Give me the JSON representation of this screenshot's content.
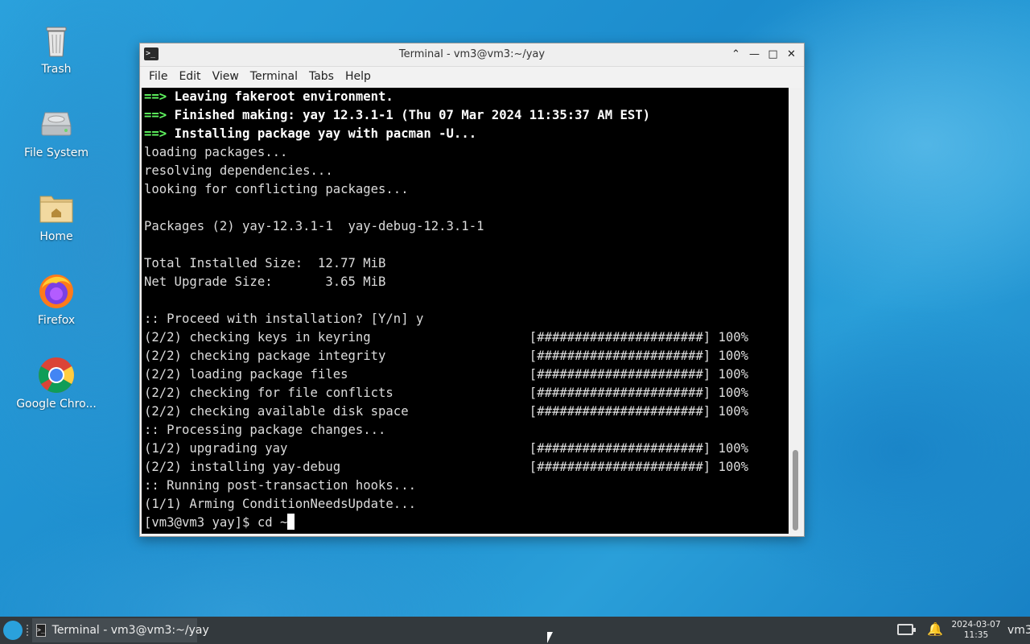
{
  "desktop": {
    "icons": [
      {
        "label": "Trash",
        "icon": "trash-icon"
      },
      {
        "label": "File System",
        "icon": "drive-icon"
      },
      {
        "label": "Home",
        "icon": "home-folder-icon"
      },
      {
        "label": "Firefox",
        "icon": "firefox-icon"
      },
      {
        "label": "Google Chro...",
        "icon": "chrome-icon"
      }
    ]
  },
  "window": {
    "title": "Terminal - vm3@vm3:~/yay",
    "menu": [
      "File",
      "Edit",
      "View",
      "Terminal",
      "Tabs",
      "Help"
    ],
    "controls": {
      "minimize": "—",
      "maximize": "□",
      "close": "✕",
      "shade": "⌃"
    }
  },
  "terminal": {
    "lines": [
      {
        "prefix": "==> ",
        "text": "Leaving fakeroot environment.",
        "style": "bold"
      },
      {
        "prefix": "==> ",
        "text": "Finished making: yay 12.3.1-1 (Thu 07 Mar 2024 11:35:37 AM EST)",
        "style": "bold"
      },
      {
        "prefix": "==> ",
        "text": "Installing package yay with pacman -U...",
        "style": "bold"
      },
      {
        "prefix": "",
        "text": "loading packages...",
        "style": "normal"
      },
      {
        "prefix": "",
        "text": "resolving dependencies...",
        "style": "normal"
      },
      {
        "prefix": "",
        "text": "looking for conflicting packages...",
        "style": "normal"
      },
      {
        "prefix": "",
        "text": "",
        "style": "normal"
      },
      {
        "prefix": "",
        "text": "Packages (2) yay-12.3.1-1  yay-debug-12.3.1-1",
        "style": "normal"
      },
      {
        "prefix": "",
        "text": "",
        "style": "normal"
      },
      {
        "prefix": "",
        "text": "Total Installed Size:  12.77 MiB",
        "style": "normal"
      },
      {
        "prefix": "",
        "text": "Net Upgrade Size:       3.65 MiB",
        "style": "normal"
      },
      {
        "prefix": "",
        "text": "",
        "style": "normal"
      },
      {
        "prefix": "",
        "text": ":: Proceed with installation? [Y/n] y",
        "style": "normal"
      },
      {
        "prefix": "",
        "text": "(2/2) checking keys in keyring                     [######################] 100%",
        "style": "normal"
      },
      {
        "prefix": "",
        "text": "(2/2) checking package integrity                   [######################] 100%",
        "style": "normal"
      },
      {
        "prefix": "",
        "text": "(2/2) loading package files                        [######################] 100%",
        "style": "normal"
      },
      {
        "prefix": "",
        "text": "(2/2) checking for file conflicts                  [######################] 100%",
        "style": "normal"
      },
      {
        "prefix": "",
        "text": "(2/2) checking available disk space                [######################] 100%",
        "style": "normal"
      },
      {
        "prefix": "",
        "text": ":: Processing package changes...",
        "style": "normal"
      },
      {
        "prefix": "",
        "text": "(1/2) upgrading yay                                [######################] 100%",
        "style": "normal"
      },
      {
        "prefix": "",
        "text": "(2/2) installing yay-debug                         [######################] 100%",
        "style": "normal"
      },
      {
        "prefix": "",
        "text": ":: Running post-transaction hooks...",
        "style": "normal"
      },
      {
        "prefix": "",
        "text": "(1/1) Arming ConditionNeedsUpdate...",
        "style": "normal"
      }
    ],
    "prompt": "[vm3@vm3 yay]$ ",
    "input": "cd ~",
    "colors": {
      "arrow": "#5ff55f",
      "bg": "#000000",
      "fg": "#dcdcdc"
    }
  },
  "taskbar": {
    "task_label": "Terminal - vm3@vm3:~/yay",
    "clock_date": "2024-03-07",
    "clock_time": "11:35",
    "user": "vm3"
  }
}
